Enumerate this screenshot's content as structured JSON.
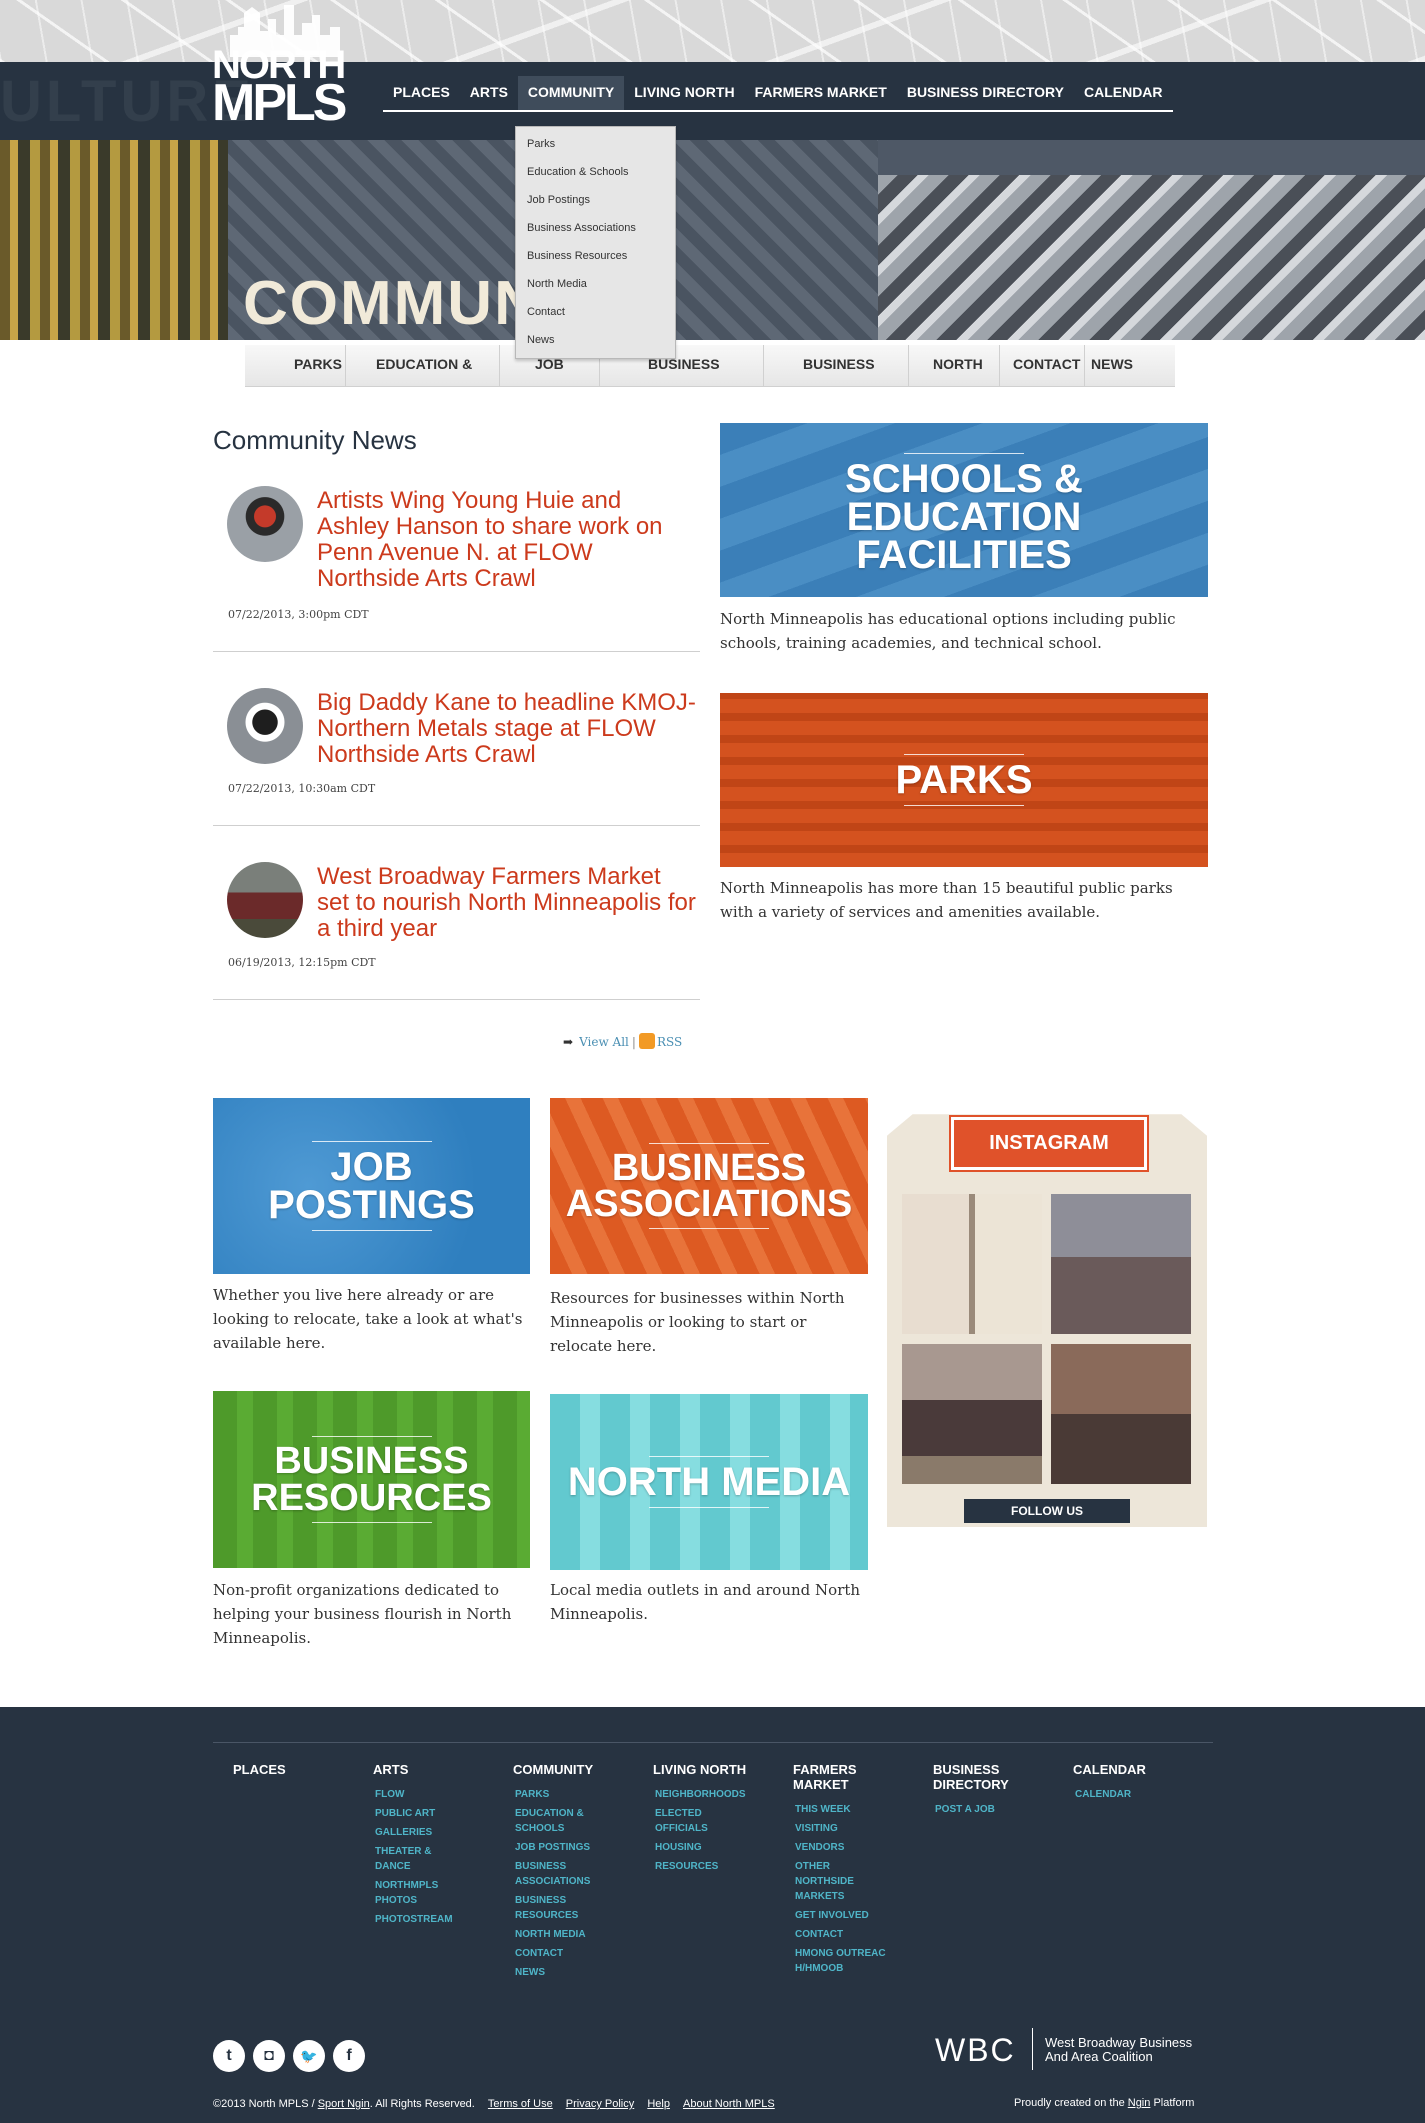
{
  "logo": {
    "line1": "NORTH",
    "line2": "MPLS"
  },
  "nav": {
    "items": [
      "PLACES",
      "ARTS",
      "COMMUNITY",
      "LIVING NORTH",
      "FARMERS MARKET",
      "BUSINESS DIRECTORY",
      "CALENDAR"
    ],
    "active": "COMMUNITY"
  },
  "dropdown": {
    "items": [
      "Parks",
      "Education & Schools",
      "Job Postings",
      "Business Associations",
      "Business Resources",
      "North Media",
      "Contact",
      "News"
    ]
  },
  "hero": {
    "title": "COMMUN"
  },
  "subnav": {
    "items": [
      "PARKS",
      "EDUCATION &",
      "JOB",
      "BUSINESS",
      "BUSINESS",
      "NORTH",
      "CONTACT",
      "NEWS"
    ]
  },
  "news": {
    "heading": "Community News",
    "items": [
      {
        "headline": "Artists Wing Young Huie and Ashley Hanson to share work on Penn Avenue N. at FLOW Northside Arts Crawl",
        "date": "07/22/2013, 3:00pm CDT"
      },
      {
        "headline": "Big Daddy Kane to headline KMOJ-Northern Metals stage at FLOW Northside Arts Crawl",
        "date": "07/22/2013, 10:30am CDT"
      },
      {
        "headline": "West Broadway Farmers Market set to nourish North Minneapolis for a third year",
        "date": "06/19/2013, 12:15pm CDT"
      }
    ],
    "view_all": "View All",
    "rss": "RSS"
  },
  "features": {
    "schools": {
      "title": "SCHOOLS & EDUCATION FACILITIES",
      "desc": "North Minneapolis has educational options including public schools, training academies, and technical school."
    },
    "parks": {
      "title": "PARKS",
      "desc": "North Minneapolis has more than 15 beautiful public parks with a variety of services and amenities available."
    },
    "jobs": {
      "title": "JOB POSTINGS",
      "desc": "Whether you live here already or are looking to relocate, take a look at what's available here."
    },
    "associations": {
      "title": "BUSINESS ASSOCIATIONS",
      "desc": "Resources for businesses within North Minneapolis or looking to start or relocate here."
    },
    "resources": {
      "title": "BUSINESS RESOURCES",
      "desc": "Non-profit organizations dedicated to helping your business flourish in North Minneapolis."
    },
    "media": {
      "title": "NORTH MEDIA",
      "desc": "Local media outlets in and around North Minneapolis."
    }
  },
  "instagram": {
    "title": "INSTAGRAM",
    "follow": "FOLLOW US"
  },
  "footer": {
    "columns": [
      {
        "head": "PLACES",
        "links": []
      },
      {
        "head": "ARTS",
        "links": [
          "FLOW",
          "PUBLIC ART",
          "GALLERIES",
          "THEATER & DANCE",
          "NORTHMPLS PHOTOS",
          "PHOTOSTREAM"
        ]
      },
      {
        "head": "COMMUNITY",
        "links": [
          "PARKS",
          "EDUCATION & SCHOOLS",
          "JOB POSTINGS",
          "BUSINESS ASSOCIATIONS",
          "BUSINESS RESOURCES",
          "NORTH MEDIA",
          "CONTACT",
          "NEWS"
        ]
      },
      {
        "head": "LIVING NORTH",
        "links": [
          "NEIGHBORHOODS",
          "ELECTED OFFICIALS",
          "HOUSING",
          "RESOURCES"
        ]
      },
      {
        "head": "FARMERS MARKET",
        "links": [
          "THIS WEEK",
          "VISITING",
          "VENDORS",
          "OTHER NORTHSIDE MARKETS",
          "GET INVOLVED",
          "CONTACT",
          "HMONG OUTREACH/HMOOB"
        ]
      },
      {
        "head": "BUSINESS DIRECTORY",
        "links": [
          "POST A JOB"
        ]
      },
      {
        "head": "CALENDAR",
        "links": [
          "CALENDAR"
        ]
      }
    ],
    "social": {
      "tumblr": "t",
      "instagram": "◘",
      "twitter": "🐦",
      "facebook": "f"
    },
    "wbc": {
      "abbr": "WBC",
      "line1": "West Broadway Business",
      "line2": "And Area Coalition"
    },
    "copyright": "©2013 North MPLS /",
    "sport_ngin": "Sport Ngin",
    "rights": ". All Rights Reserved.",
    "links": [
      "Terms of Use",
      "Privacy Policy",
      "Help",
      "About North MPLS"
    ],
    "platform_pre": "Proudly created on the",
    "platform_link": "Ngin",
    "platform_post": "Platform"
  },
  "colors": {
    "navy": "#273341",
    "headline_red": "#cc3a1c",
    "link_teal": "#4fb5c8",
    "schools_blue": "#3b7fb8",
    "parks_orange": "#d4521f",
    "jobs_blue": "#2f7fbf",
    "assoc_orange": "#dd5a22",
    "resources_green": "#4e9a2a",
    "media_teal": "#62c9cf"
  }
}
